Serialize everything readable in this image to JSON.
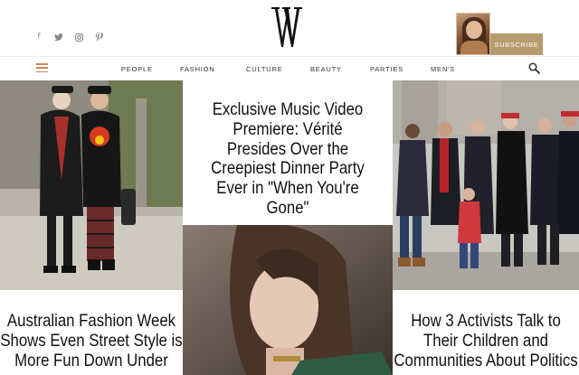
{
  "header": {
    "social": [
      {
        "icon": "facebook-icon",
        "glyph": "f"
      },
      {
        "icon": "twitter-icon",
        "glyph": "🐦"
      },
      {
        "icon": "instagram-icon",
        "glyph": "◎"
      },
      {
        "icon": "pinterest-icon",
        "glyph": "℗"
      }
    ],
    "logo_text": "W",
    "subscribe_label": "SUBSCRIBE"
  },
  "nav": {
    "menu_icon": "hamburger-icon",
    "items": [
      "PEOPLE",
      "FASHION",
      "CULTURE",
      "BEAUTY",
      "PARTIES",
      "MEN'S"
    ],
    "search_icon": "search-icon"
  },
  "articles": {
    "left": {
      "headline": "Australian Fashion Week Shows Even Street Style is More Fun Down Under"
    },
    "middle": {
      "headline": "Exclusive Music Video Premiere: Vérité Presides Over the Creepiest Dinner Party Ever in \"When You're Gone\""
    },
    "right": {
      "headline": "How 3 Activists Talk to Their Children and Communities About Politics"
    }
  },
  "colors": {
    "accent": "#b69b6e",
    "menu_accent": "#c58b55",
    "icon_gray": "#8a8a8a"
  }
}
